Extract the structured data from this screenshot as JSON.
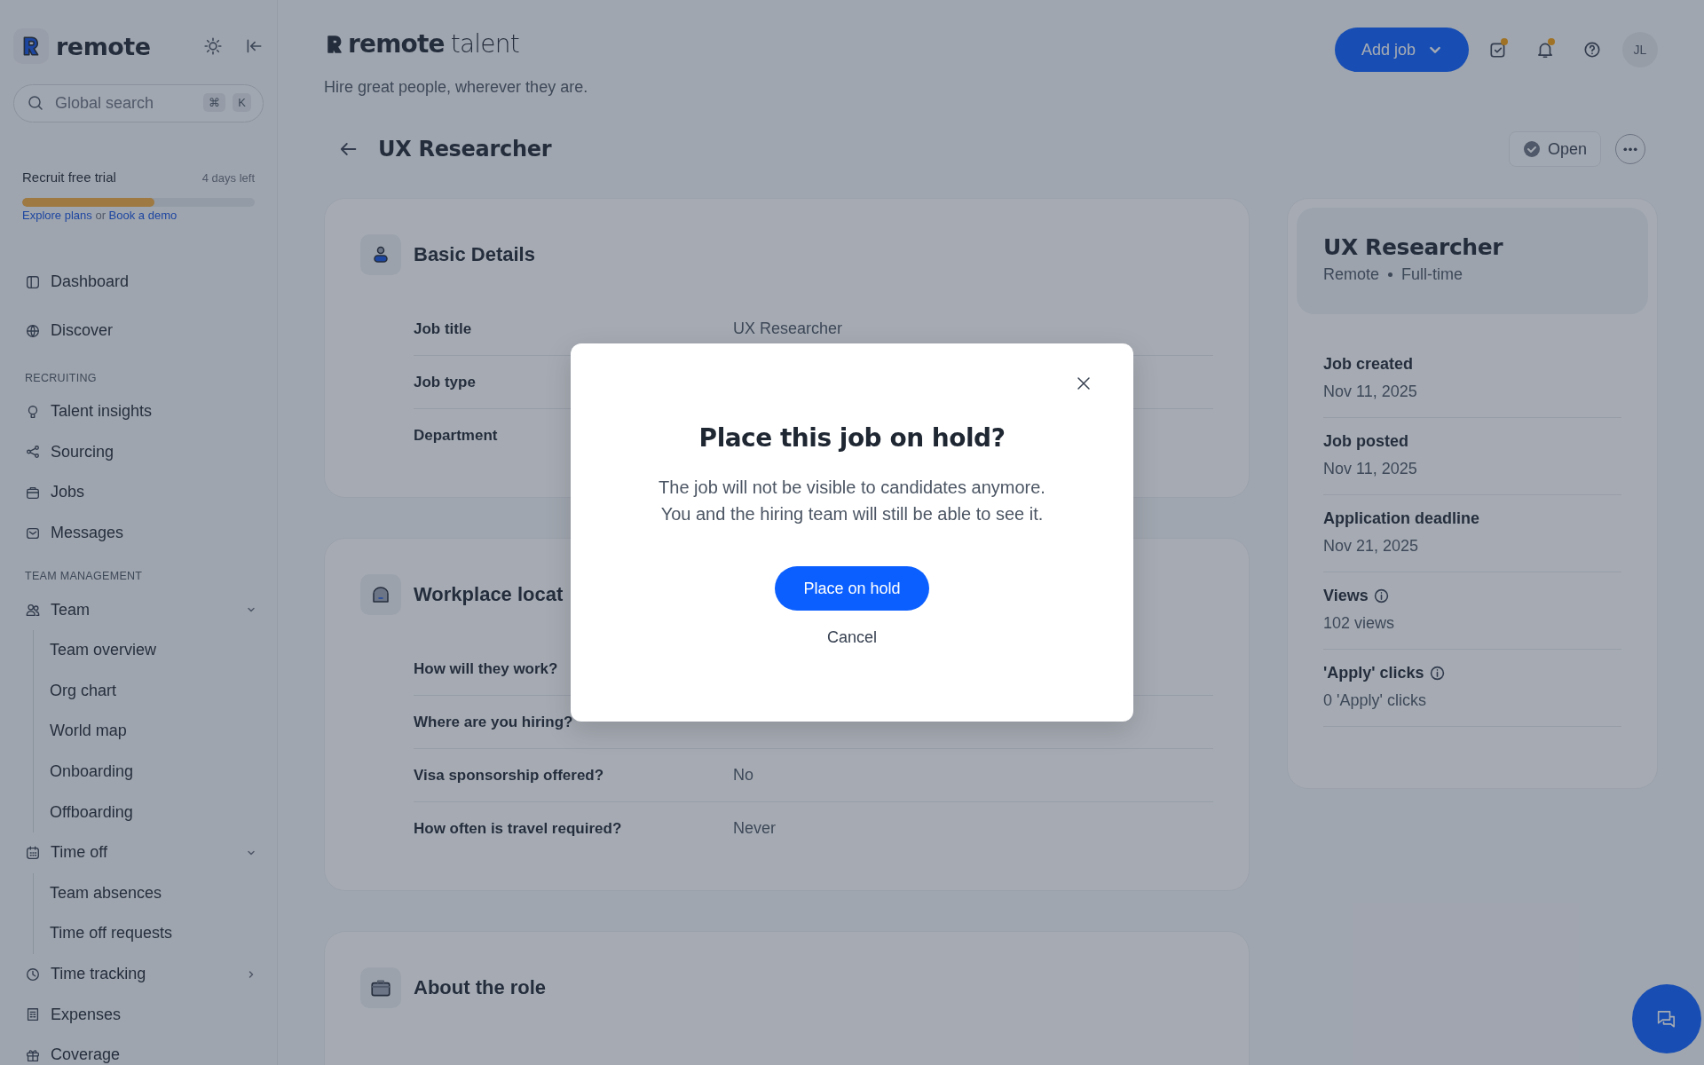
{
  "sidebar": {
    "brand": "remote",
    "search": {
      "placeholder": "Global search",
      "keys": [
        "⌘",
        "K"
      ]
    },
    "trial": {
      "title": "Recruit free trial",
      "remaining": "4 days left",
      "level": 0.57,
      "link_1": "Explore plans",
      "connector": "or",
      "link_2": "Book a demo"
    },
    "nav": [
      {
        "kind": "link",
        "label": "Dashboard"
      },
      {
        "kind": "link",
        "label": "Discover"
      },
      {
        "kind": "section",
        "label": "RECRUITING"
      },
      {
        "kind": "link",
        "label": "Talent insights"
      },
      {
        "kind": "link",
        "label": "Sourcing"
      },
      {
        "kind": "link",
        "label": "Jobs"
      },
      {
        "kind": "link",
        "label": "Messages"
      },
      {
        "kind": "section",
        "label": "TEAM MANAGEMENT"
      },
      {
        "kind": "group",
        "label": "Team",
        "expanded": true,
        "children": [
          {
            "label": "Team overview"
          },
          {
            "label": "Org chart"
          },
          {
            "label": "World map"
          },
          {
            "label": "Onboarding"
          },
          {
            "label": "Offboarding"
          }
        ]
      },
      {
        "kind": "group",
        "label": "Time off",
        "expanded": true,
        "children": [
          {
            "label": "Team absences"
          },
          {
            "label": "Time off requests"
          }
        ]
      },
      {
        "kind": "group",
        "label": "Time tracking",
        "expanded": false
      },
      {
        "kind": "link",
        "label": "Expenses"
      },
      {
        "kind": "link",
        "label": "Coverage"
      }
    ]
  },
  "header": {
    "brand_bold": "remote",
    "brand_light": "talent",
    "tagline": "Hire great people, wherever they are.",
    "add_button": "Add job",
    "icons": [
      {
        "kind": "tasks",
        "unread": true
      },
      {
        "kind": "bell",
        "unread": true
      },
      {
        "kind": "help",
        "unread": false
      }
    ],
    "avatar": "JL"
  },
  "job": {
    "title": "UX Researcher",
    "status": "Open"
  },
  "cards": [
    {
      "kind": "person",
      "title": "Basic Details",
      "rows": [
        {
          "label": "Job title",
          "value": "UX Researcher"
        },
        {
          "label": "Job type"
        },
        {
          "label": "Department"
        }
      ]
    },
    {
      "kind": "building",
      "title": "Workplace locat",
      "rows": [
        {
          "label": "How will they work?"
        },
        {
          "label": "Where are you hiring?"
        },
        {
          "label": "Visa sponsorship offered?",
          "value": "No"
        },
        {
          "label": "How often is travel required?",
          "value": "Never"
        }
      ]
    },
    {
      "kind": "briefcase",
      "title": "About the role"
    }
  ],
  "summary": {
    "title": "UX Researcher",
    "meta": [
      "Remote",
      "Full-time"
    ],
    "stats": [
      {
        "label": "Job created",
        "value": "Nov 11, 2025",
        "info": false
      },
      {
        "label": "Job posted",
        "value": "Nov 11, 2025",
        "info": false
      },
      {
        "label": "Application deadline",
        "value": "Nov 21, 2025",
        "info": false
      },
      {
        "label": "Views",
        "value": "102 views",
        "info": true
      },
      {
        "label": "'Apply' clicks",
        "value": "0 'Apply' clicks",
        "info": true
      }
    ]
  },
  "dialog": {
    "title": "Place this job on hold?",
    "body": [
      "The job will not be visible to candidates anymore.",
      "You and the hiring team will still be able to see it."
    ],
    "confirm": "Place on hold",
    "cancel": "Cancel"
  }
}
